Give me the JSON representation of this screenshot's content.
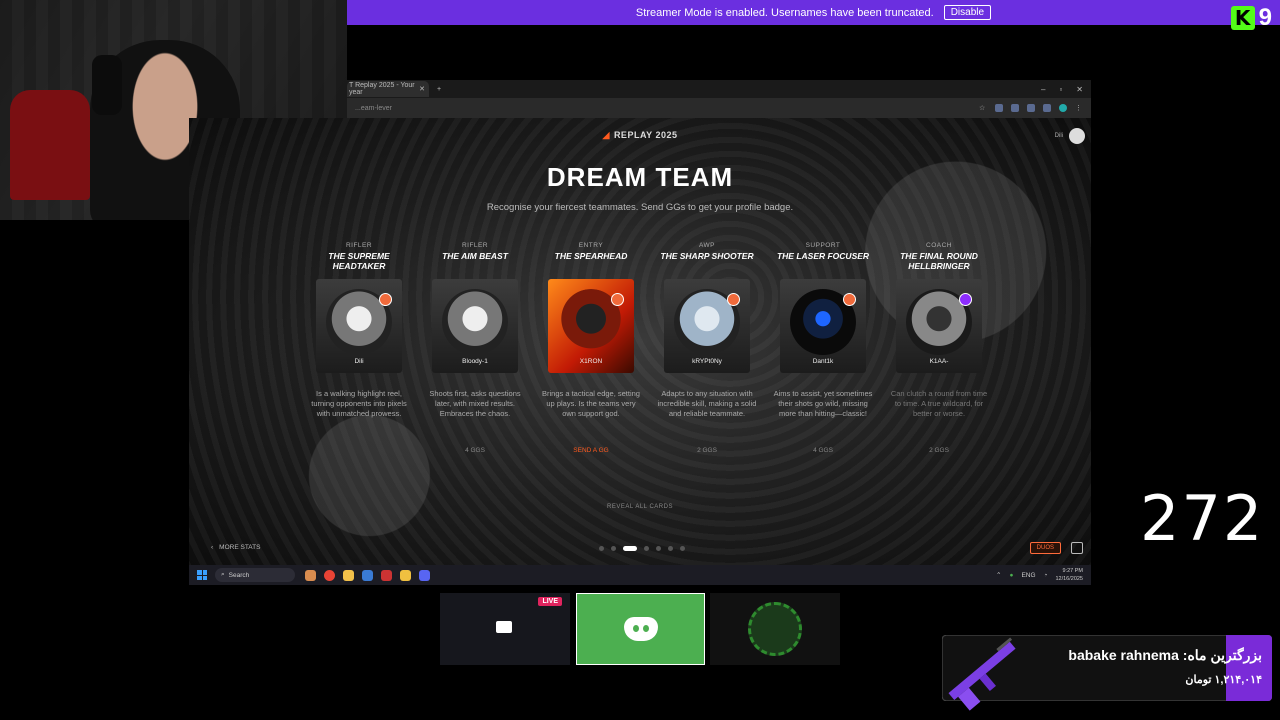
{
  "banner": {
    "text": "Streamer Mode is enabled. Usernames have been truncated.",
    "button": "Disable"
  },
  "overlay": {
    "kick_count": "9",
    "counter": "272"
  },
  "browser": {
    "tab_title": "T Replay 2025 - Your year",
    "url": "...eam-lever"
  },
  "page": {
    "replay_label": "REPLAY 2025",
    "title": "DREAM TEAM",
    "subtitle": "Recognise your fiercest teammates. Send GGs to get your profile badge.",
    "user_name": "Dili",
    "reveal": "REVEAL ALL CARDS",
    "more_stats": "MORE STATS",
    "duos": "DUOS"
  },
  "cards": [
    {
      "role": "RIFLER",
      "title": "THE SUPREME HEADTAKER",
      "player": "Dili",
      "desc": "Is a walking highlight reel, turning opponents into pixels with unmatched prowess.",
      "ggs": ""
    },
    {
      "role": "RIFLER",
      "title": "THE AIM BEAST",
      "player": "Bloody-1",
      "desc": "Shoots first, asks questions later, with mixed results. Embraces the chaos.",
      "ggs": "4 GGS"
    },
    {
      "role": "ENTRY",
      "title": "THE SPEARHEAD",
      "player": "X1RON",
      "desc": "Brings a tactical edge, setting up plays. Is the teams very own support god.",
      "ggs": "SEND A GG"
    },
    {
      "role": "AWP",
      "title": "THE SHARP SHOOTER",
      "player": "kRYPt0Ny",
      "desc": "Adapts to any situation with incredible skill, making a solid and reliable teammate.",
      "ggs": "2 GGS"
    },
    {
      "role": "SUPPORT",
      "title": "THE LASER FOCUSER",
      "player": "Dant1k",
      "desc": "Aims to assist, yet sometimes their shots go wild, missing more than hitting—classic!",
      "ggs": "4 GGS"
    },
    {
      "role": "COACH",
      "title": "THE FINAL ROUND HELLBRINGER",
      "player": "K1AA-",
      "desc": "Can clutch a round from time to time. A true wildcard, for better or worse.",
      "ggs": "2 GGS"
    }
  ],
  "taskbar": {
    "search": "Search",
    "lang": "ENG",
    "time": "9:27 PM",
    "date": "12/16/2025"
  },
  "thumb": {
    "live": "LIVE"
  },
  "donation": {
    "line1": "بزرگترین ماه: babake rahnema",
    "line2": "۱,۲۱۴,۰۱۴ تومان"
  },
  "colors": {
    "banner": "#6b2fe0",
    "accent": "#ff5a1f",
    "discord_green": "#4caf50",
    "kick_green": "#53fc18"
  }
}
